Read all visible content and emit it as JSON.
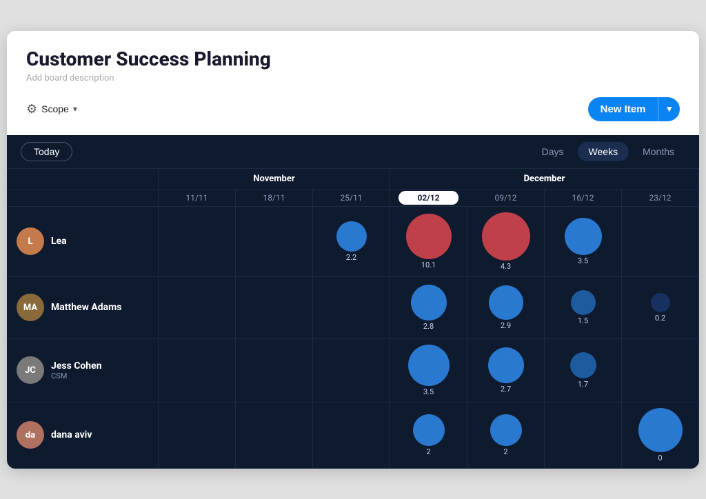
{
  "header": {
    "title": "Customer Success Planning",
    "subtitle": "Add board description",
    "scope_label": "Scope",
    "new_item_label": "New Item",
    "new_item_arrow": "▾"
  },
  "toolbar": {
    "today_label": "Today",
    "views": [
      "Days",
      "Weeks",
      "Months"
    ],
    "active_view": "Weeks"
  },
  "calendar": {
    "months": [
      {
        "label": "November",
        "span_start": 1,
        "span_count": 3
      },
      {
        "label": "December",
        "span_start": 4,
        "span_count": 4
      }
    ],
    "weeks": [
      "11/11",
      "18/11",
      "25/11",
      "02/12",
      "09/12",
      "16/12",
      "23/12"
    ],
    "today_col": "02/12"
  },
  "rows": [
    {
      "name": "Lea",
      "role": "",
      "avatar_emoji": "👩",
      "avatar_class": "av-lea",
      "bubbles": [
        {
          "col": 2,
          "size": 44,
          "color": "bubble-blue-md",
          "value": "2.2"
        },
        {
          "col": 3,
          "size": 66,
          "color": "bubble-red",
          "value": "10.1"
        },
        {
          "col": 4,
          "size": 70,
          "color": "bubble-red",
          "value": "4.3"
        },
        {
          "col": 5,
          "size": 54,
          "color": "bubble-blue-md",
          "value": "3.5"
        }
      ]
    },
    {
      "name": "Matthew Adams",
      "role": "",
      "avatar_emoji": "🐻",
      "avatar_class": "av-matthew",
      "bubbles": [
        {
          "col": 3,
          "size": 52,
          "color": "bubble-blue-md",
          "value": "2.8"
        },
        {
          "col": 4,
          "size": 50,
          "color": "bubble-blue-md",
          "value": "2.9"
        },
        {
          "col": 5,
          "size": 36,
          "color": "bubble-blue-sm",
          "value": "1.5"
        },
        {
          "col": 6,
          "size": 28,
          "color": "bubble-dark",
          "value": "0.2"
        }
      ]
    },
    {
      "name": "Jess Cohen",
      "role": "CSM",
      "avatar_emoji": "👩",
      "avatar_class": "av-jess",
      "bubbles": [
        {
          "col": 3,
          "size": 60,
          "color": "bubble-blue-md",
          "value": "3.5"
        },
        {
          "col": 4,
          "size": 52,
          "color": "bubble-blue-md",
          "value": "2.7"
        },
        {
          "col": 5,
          "size": 38,
          "color": "bubble-blue-sm",
          "value": "1.7"
        }
      ]
    },
    {
      "name": "dana aviv",
      "role": "",
      "avatar_emoji": "👩",
      "avatar_class": "av-dana",
      "bubbles": [
        {
          "col": 3,
          "size": 46,
          "color": "bubble-blue-md",
          "value": "2"
        },
        {
          "col": 4,
          "size": 46,
          "color": "bubble-blue-md",
          "value": "2"
        },
        {
          "col": 6,
          "size": 64,
          "color": "bubble-blue-lg",
          "value": "0"
        }
      ]
    }
  ]
}
